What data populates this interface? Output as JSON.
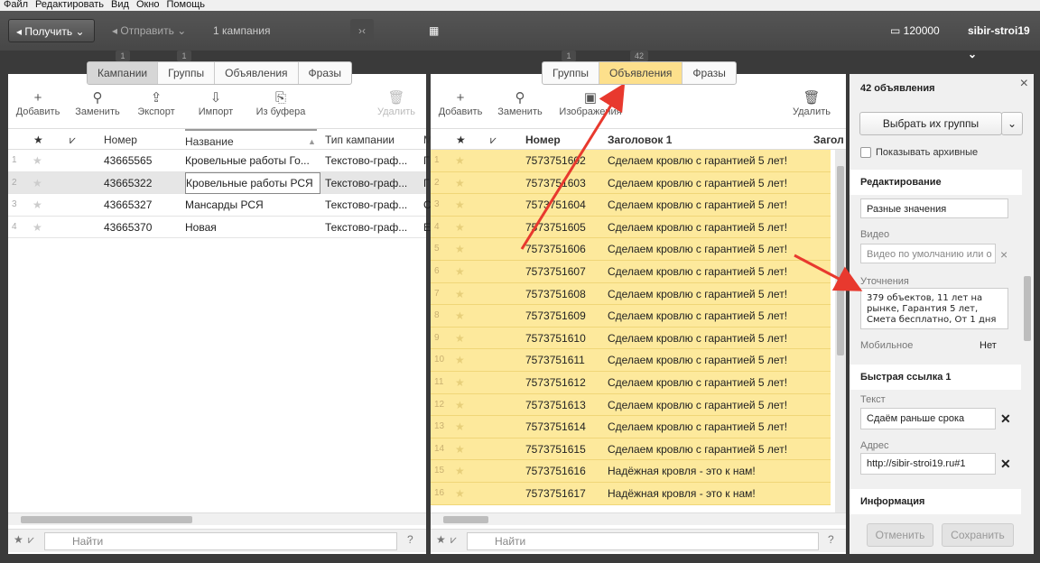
{
  "menu": [
    "Файл",
    "Редактировать",
    "Вид",
    "Окно",
    "Помощь"
  ],
  "toolbar": {
    "get_label": "Получить",
    "send_label": "Отправить",
    "campaigns_count": "1 кампания",
    "balance": "120000",
    "user": "sibir-stroi19"
  },
  "left": {
    "counters": [
      "1",
      "1"
    ],
    "tabs": [
      "Кампании",
      "Группы",
      "Объявления",
      "Фразы"
    ],
    "tools": [
      {
        "icon": "+",
        "label": "Добавить"
      },
      {
        "icon": "⚲",
        "label": "Заменить"
      },
      {
        "icon": "⇪",
        "label": "Экспорт"
      },
      {
        "icon": "⇩",
        "label": "Импорт"
      },
      {
        "icon": "⎘",
        "label": "Из буфера"
      },
      {
        "icon": "🗑",
        "label": "Удалить"
      }
    ],
    "columns": [
      "★",
      "⩗",
      "Номер",
      "Название",
      "Тип кампании",
      "М"
    ],
    "rows": [
      {
        "n": "1",
        "id": "43665565",
        "name": "Кровельные работы Го...",
        "type": "Текстово-граф...",
        "m": "Г"
      },
      {
        "n": "2",
        "id": "43665322",
        "name": "Кровельные работы РСЯ",
        "type": "Текстово-граф...",
        "m": "Г"
      },
      {
        "n": "3",
        "id": "43665327",
        "name": "Мансарды РСЯ",
        "type": "Текстово-граф...",
        "m": "С"
      },
      {
        "n": "4",
        "id": "43665370",
        "name": "Новая",
        "type": "Текстово-граф...",
        "m": "Е"
      }
    ],
    "search_placeholder": "Найти"
  },
  "mid": {
    "counters": [
      "1",
      "42"
    ],
    "tabs": [
      "Группы",
      "Объявления",
      "Фразы"
    ],
    "tools": [
      {
        "icon": "+",
        "label": "Добавить"
      },
      {
        "icon": "⚲",
        "label": "Заменить"
      },
      {
        "icon": "▣",
        "label": "Изображения"
      },
      {
        "icon": "🗑",
        "label": "Удалить"
      }
    ],
    "columns": [
      "★",
      "⩗",
      "Номер",
      "Заголовок 1",
      "Загол"
    ],
    "rows": [
      {
        "n": "1",
        "id": "7573751602",
        "title": "Сделаем кровлю с гарантией 5 лет!"
      },
      {
        "n": "2",
        "id": "7573751603",
        "title": "Сделаем кровлю с гарантией 5 лет!"
      },
      {
        "n": "3",
        "id": "7573751604",
        "title": "Сделаем кровлю с гарантией 5 лет!"
      },
      {
        "n": "4",
        "id": "7573751605",
        "title": "Сделаем кровлю с гарантией 5 лет!"
      },
      {
        "n": "5",
        "id": "7573751606",
        "title": "Сделаем кровлю с гарантией 5 лет!"
      },
      {
        "n": "6",
        "id": "7573751607",
        "title": "Сделаем кровлю с гарантией 5 лет!"
      },
      {
        "n": "7",
        "id": "7573751608",
        "title": "Сделаем кровлю с гарантией 5 лет!"
      },
      {
        "n": "8",
        "id": "7573751609",
        "title": "Сделаем кровлю с гарантией 5 лет!"
      },
      {
        "n": "9",
        "id": "7573751610",
        "title": "Сделаем кровлю с гарантией 5 лет!"
      },
      {
        "n": "10",
        "id": "7573751611",
        "title": "Сделаем кровлю с гарантией 5 лет!"
      },
      {
        "n": "11",
        "id": "7573751612",
        "title": "Сделаем кровлю с гарантией 5 лет!"
      },
      {
        "n": "12",
        "id": "7573751613",
        "title": "Сделаем кровлю с гарантией 5 лет!"
      },
      {
        "n": "13",
        "id": "7573751614",
        "title": "Сделаем кровлю с гарантией 5 лет!"
      },
      {
        "n": "14",
        "id": "7573751615",
        "title": "Сделаем кровлю с гарантией 5 лет!"
      },
      {
        "n": "15",
        "id": "7573751616",
        "title": "Надёжная кровля - это к нам!"
      },
      {
        "n": "16",
        "id": "7573751617",
        "title": "Надёжная кровля - это к нам!"
      }
    ],
    "search_placeholder": "Найти"
  },
  "right": {
    "title": "42 объявления",
    "choose_groups": "Выбрать их группы",
    "show_archived": "Показывать архивные",
    "editing_header": "Редактирование",
    "text_value": "Разные значения",
    "video_label": "Видео",
    "video_placeholder": "Видео по умолчанию или о",
    "callouts_label": "Уточнения",
    "callouts_value": "379 объектов, 11 лет на рынке, Гарантия 5 лет, Смета бесплатно, От 1 дня",
    "mobile_label": "Мобильное",
    "mobile_value": "Нет",
    "sitelink_header": "Быстрая ссылка 1",
    "sitelink_text_label": "Текст",
    "sitelink_text_value": "Сдаём раньше срока",
    "sitelink_url_label": "Адрес",
    "sitelink_url_value": "http://sibir-stroi19.ru#1",
    "info_header": "Информация",
    "cancel": "Отменить",
    "save": "Сохранить"
  },
  "colors": {
    "accent_yellow": "#fde99c",
    "annotation_arrow": "#e8392e"
  }
}
